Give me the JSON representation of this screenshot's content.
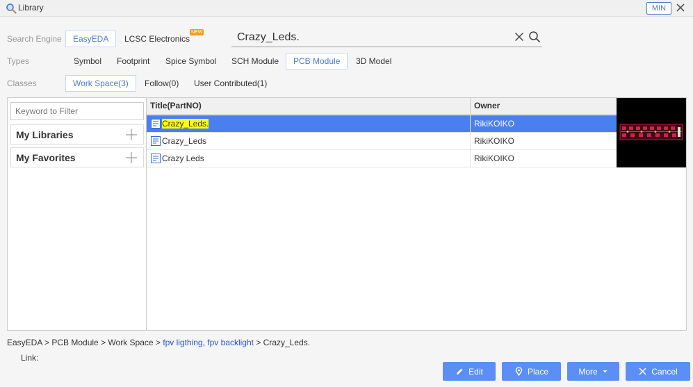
{
  "window": {
    "title": "Library",
    "min_label": "MIN"
  },
  "search_engine": {
    "label": "Search Engine",
    "options": [
      "EasyEDA",
      "LCSC Electronics"
    ],
    "selected": "EasyEDA",
    "new_badge": "NEW"
  },
  "search": {
    "query": "Crazy_Leds."
  },
  "types": {
    "label": "Types",
    "options": [
      "Symbol",
      "Footprint",
      "Spice Symbol",
      "SCH Module",
      "PCB Module",
      "3D Model"
    ],
    "selected": "PCB Module"
  },
  "classes": {
    "label": "Classes",
    "options": [
      "Work Space(3)",
      "Follow(0)",
      "User Contributed(1)"
    ],
    "selected": "Work Space(3)"
  },
  "left_panel": {
    "filter_placeholder": "Keyword to Filter",
    "items": [
      "My Libraries",
      "My Favorites"
    ]
  },
  "table": {
    "headers": [
      "Title(PartNO)",
      "Owner"
    ],
    "rows": [
      {
        "title": "Crazy_Leds.",
        "owner": "RikiKOIKO",
        "selected": true
      },
      {
        "title": "Crazy_Leds",
        "owner": "RikiKOIKO",
        "selected": false
      },
      {
        "title": "Crazy Leds",
        "owner": "RikiKOIKO",
        "selected": false
      }
    ]
  },
  "breadcrumb": {
    "prefix": "EasyEDA > PCB Module > Work Space > ",
    "tags": [
      "fpv ligthing",
      "fpv backlight"
    ],
    "tag_sep": ", ",
    "sep": " > ",
    "current": "Crazy_Leds."
  },
  "link": {
    "label": "Link:"
  },
  "buttons": {
    "edit": "Edit",
    "place": "Place",
    "more": "More",
    "cancel": "Cancel"
  },
  "colors": {
    "accent": "#4a7bd0",
    "selection": "#4a7ff0",
    "highlight": "#ffff00",
    "button": "#5b8ff5"
  }
}
